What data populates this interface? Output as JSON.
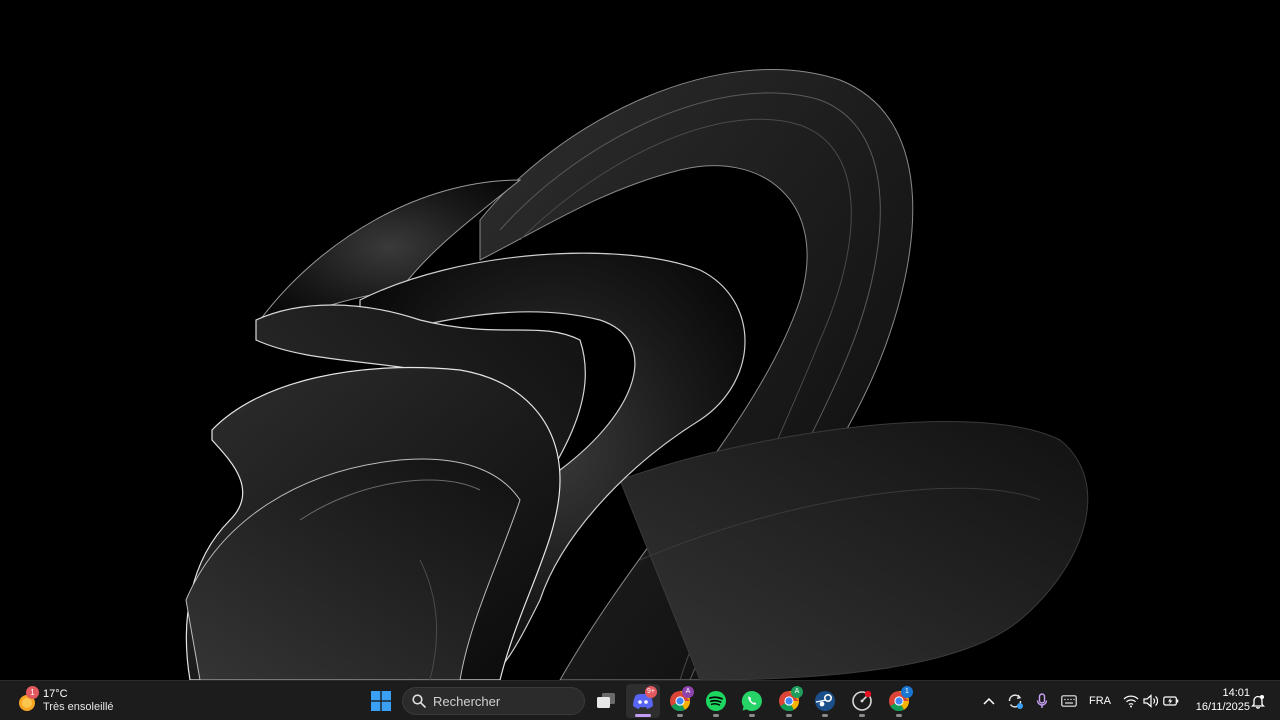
{
  "weather": {
    "badge": "1",
    "temperature": "17°C",
    "condition": "Très ensoleillé"
  },
  "search": {
    "placeholder": "Rechercher"
  },
  "apps": [
    {
      "name": "Discord",
      "badge": "9+",
      "running": true,
      "focused": true
    },
    {
      "name": "Google Chrome (profile A)",
      "badge": "A",
      "running": true
    },
    {
      "name": "Spotify",
      "running": true
    },
    {
      "name": "WhatsApp",
      "running": true
    },
    {
      "name": "Google Chrome (profile A)",
      "badge": "A",
      "running": true
    },
    {
      "name": "Steam",
      "running": true
    },
    {
      "name": "App",
      "running": true
    },
    {
      "name": "Google Chrome (profile 1)",
      "badge": "1",
      "running": true
    }
  ],
  "tray": {
    "language": "FRA"
  },
  "clock": {
    "time": "14:01",
    "date": "16/11/2025"
  },
  "colors": {
    "taskbar": "#1c1c1c",
    "accent": "#c39cf5",
    "windows_blue": "#3aa0f3",
    "discord": "#5865f2",
    "spotify": "#1ed760",
    "whatsapp": "#25d366",
    "badge_red": "#e2585f"
  }
}
